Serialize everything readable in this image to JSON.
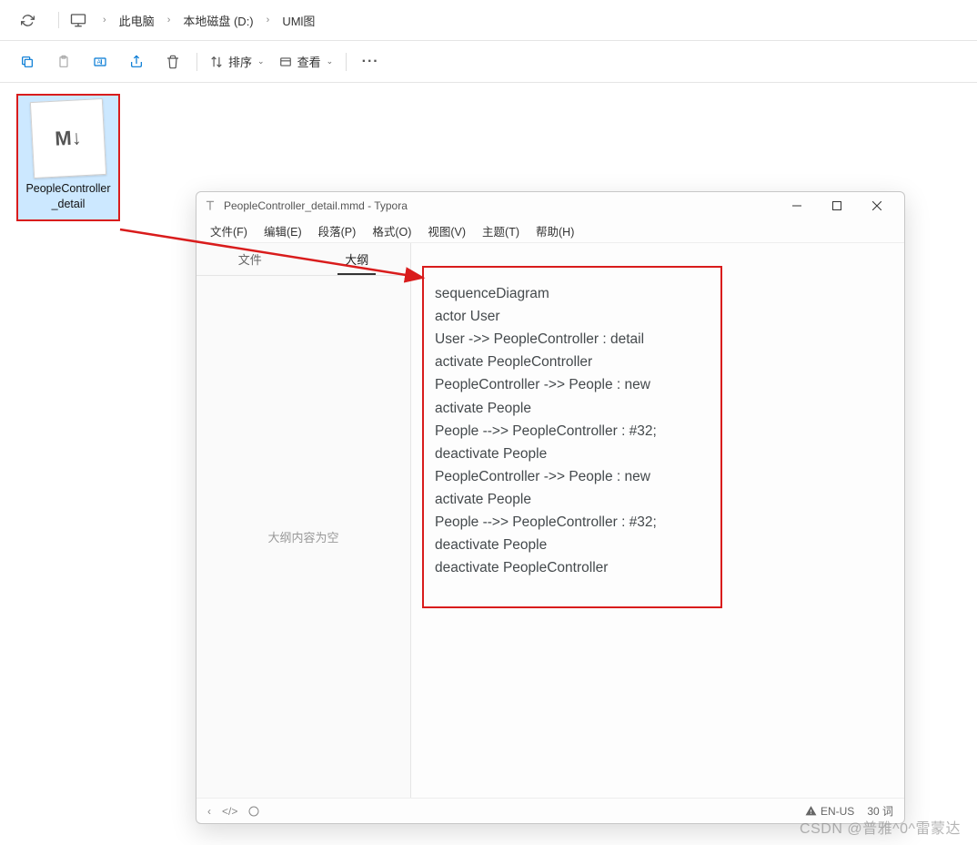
{
  "breadcrumb": {
    "items": [
      "此电脑",
      "本地磁盘 (D:)",
      "UMl图"
    ]
  },
  "toolbar": {
    "sort_label": "排序",
    "view_label": "查看"
  },
  "file": {
    "name": "PeopleController_detail",
    "badge": "M↓"
  },
  "typora": {
    "title": "PeopleController_detail.mmd - Typora",
    "menus": [
      "文件(F)",
      "编辑(E)",
      "段落(P)",
      "格式(O)",
      "视图(V)",
      "主题(T)",
      "帮助(H)"
    ],
    "sidebar": {
      "tabs": [
        "文件",
        "大纲"
      ],
      "empty": "大纲内容为空"
    },
    "content_lines": [
      "sequenceDiagram",
      "actor User",
      "User ->> PeopleController : detail",
      "activate PeopleController",
      "PeopleController ->> People : new",
      "activate People",
      "People -->> PeopleController : #32;",
      "deactivate People",
      "PeopleController ->> People : new",
      "activate People",
      "People -->> PeopleController : #32;",
      "deactivate People",
      "deactivate PeopleController"
    ],
    "status": {
      "lang": "EN-US",
      "words": "30 词"
    }
  },
  "watermark": "CSDN @普雅^0^雷蒙达"
}
